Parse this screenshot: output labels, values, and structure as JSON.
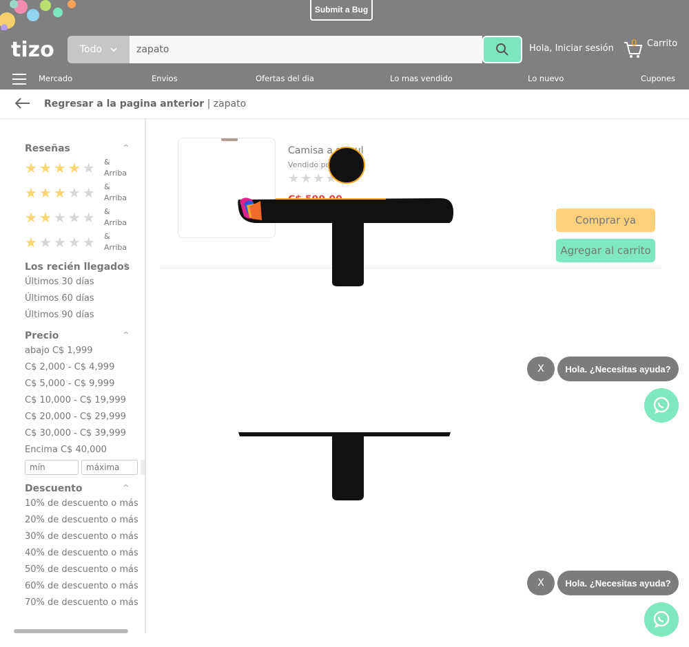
{
  "header": {
    "bug_button": "Submit a Bug",
    "search_category": "Todo",
    "search_value": "zapato",
    "login_label": "Hola, Iniciar sesión",
    "cart_count": "0",
    "cart_label": "Carrito"
  },
  "nav": {
    "items": [
      "Mercado",
      "Envios",
      "Ofertas del dia",
      "Lo mas vendido",
      "Lo nuevo",
      "Cupones"
    ]
  },
  "breadcrumb": {
    "back_label": "Regresar a la pagina anterior",
    "separator": "|",
    "query": "zapato"
  },
  "sidebar": {
    "reviews_title": "Reseñas",
    "reviews": [
      {
        "stars": 4,
        "label_amp": "&",
        "label_up": "Arriba"
      },
      {
        "stars": 3,
        "label_amp": "&",
        "label_up": "Arriba"
      },
      {
        "stars": 2,
        "label_amp": "&",
        "label_up": "Arriba"
      },
      {
        "stars": 1,
        "label_amp": "&",
        "label_up": "Arriba"
      }
    ],
    "new_title": "Los recién llegados",
    "new_items": [
      "Últimos 30 días",
      "Últimos 60 días",
      "Últimos 90 días"
    ],
    "price_title": "Precio",
    "price_items": [
      "abajo C$ 1,999",
      "C$ 2,000 - C$ 4,999",
      "C$ 5,000 - C$ 9,999",
      "C$ 10,000 - C$ 19,999",
      "C$ 20,000 - C$ 29,999",
      "C$ 30,000 - C$ 39,999",
      "Encima C$ 40,000"
    ],
    "min_placeholder": "mín",
    "max_placeholder": "máxima",
    "discount_title": "Descuento",
    "discount_items": [
      "10% de descuento o más",
      "20% de descuento o más",
      "30% de descuento o más",
      "40% de descuento o más",
      "50% de descuento o más",
      "60% de descuento o más",
      "70% de descuento o más"
    ]
  },
  "product": {
    "title": "Camisa a   s azul",
    "seller": "Vendido po",
    "price": "C$ 599.00",
    "buy_label": "Comprar ya",
    "add_label": "Agregar al carrito"
  },
  "chat": {
    "close_label": "X",
    "message": "Hola. ¿Necesitas ayuda?"
  },
  "colors": {
    "header_bg": "#808080",
    "accent_green": "#7fe8c0",
    "accent_yellow": "#fdd07b",
    "star_on": "#f9d66f"
  }
}
